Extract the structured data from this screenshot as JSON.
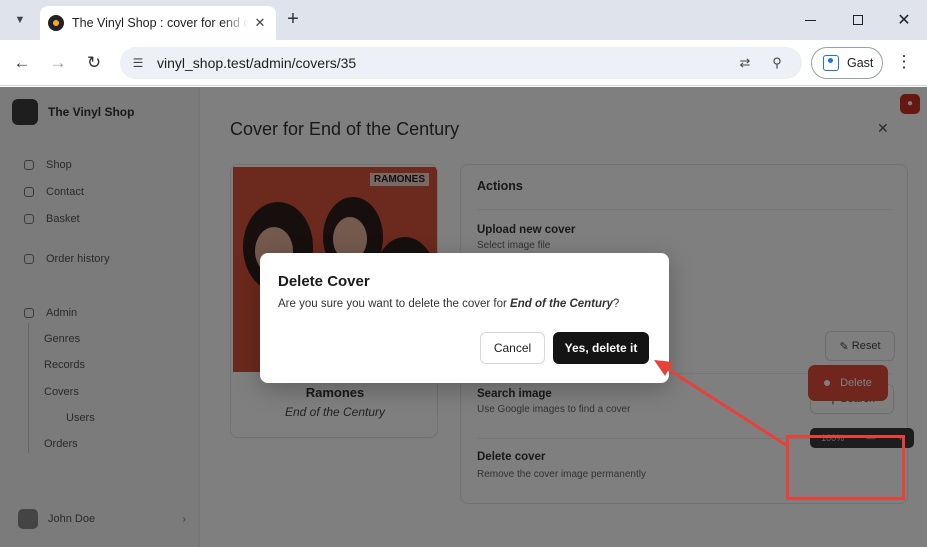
{
  "browser": {
    "tab_title": "The Vinyl Shop : cover for end of the century",
    "url": "vinyl_shop.test/admin/covers/35",
    "profile_label": "Gast"
  },
  "sidebar": {
    "brand": "The Vinyl Shop",
    "items": [
      {
        "label": "Shop"
      },
      {
        "label": "Contact"
      },
      {
        "label": "Basket"
      },
      {
        "label": "Order history"
      },
      {
        "label": "Admin"
      }
    ],
    "admin_items": [
      {
        "label": "Genres"
      },
      {
        "label": "Records"
      },
      {
        "label": "Covers"
      },
      {
        "label": "Users"
      },
      {
        "label": "Orders"
      }
    ],
    "user": "John Doe"
  },
  "main": {
    "title": "Cover for End of the Century",
    "cover": {
      "label": "RAMONES",
      "artist": "Ramones",
      "album": "End of the Century"
    },
    "actions": {
      "title": "Actions",
      "rows": [
        {
          "label": "Upload new cover",
          "desc": "Select image file",
          "button": ""
        },
        {
          "label": "",
          "desc": "",
          "button": "Reset"
        },
        {
          "label": "Search image",
          "desc": "Use Google images to find a cover",
          "button": "Search"
        },
        {
          "label": "Delete cover",
          "desc": "Remove the cover image permanently",
          "button": "Delete"
        }
      ]
    },
    "toast": [
      "100%",
      "—",
      "+"
    ]
  },
  "modal": {
    "title": "Delete Cover",
    "body_prefix": "Are you sure you want to delete the cover for ",
    "body_album": "End of the Century",
    "body_suffix": "?",
    "cancel_label": "Cancel",
    "confirm_label": "Yes, delete it"
  },
  "colors": {
    "annotation": "#e8413a",
    "delete_button": "#e04a3a",
    "confirm_button": "#141414"
  }
}
